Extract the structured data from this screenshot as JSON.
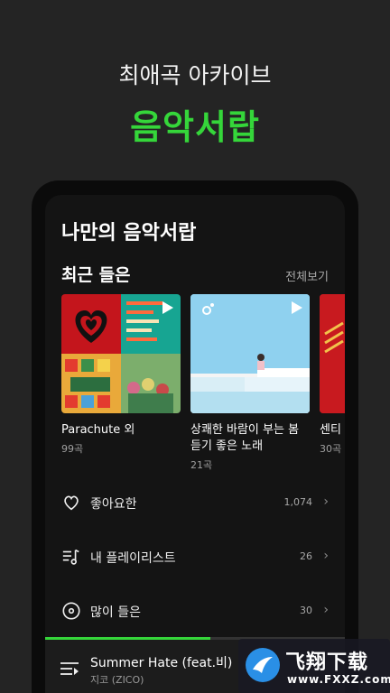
{
  "promo": {
    "subtitle": "최애곡 아카이브",
    "title": "음악서랍"
  },
  "screen": {
    "title": "나만의 음악서랍",
    "recent": {
      "section_title": "최근 들은",
      "see_all_label": "전체보기",
      "albums": [
        {
          "name": "Parachute 외",
          "count": "99곡"
        },
        {
          "name_line1": "상쾌한 바람이 부는 봄",
          "name_line2": "듣기 좋은 노래",
          "count": "21곡"
        },
        {
          "name": "센티",
          "count": "30곡"
        }
      ]
    },
    "menu": [
      {
        "label": "좋아요한",
        "count": "1,074",
        "icon": "heart-icon"
      },
      {
        "label": "내 플레이리스트",
        "count": "26",
        "icon": "playlist-icon"
      },
      {
        "label": "많이 들은",
        "count": "30",
        "icon": "disc-icon"
      }
    ],
    "player": {
      "title": "Summer Hate (feat.비)",
      "artist": "지코 (ZICO)",
      "progress": 0.55
    }
  },
  "watermark": {
    "brand": "飞翔下载",
    "url": "www.FXXZ.com"
  },
  "colors": {
    "accent": "#35d63a",
    "background": "#242424"
  }
}
